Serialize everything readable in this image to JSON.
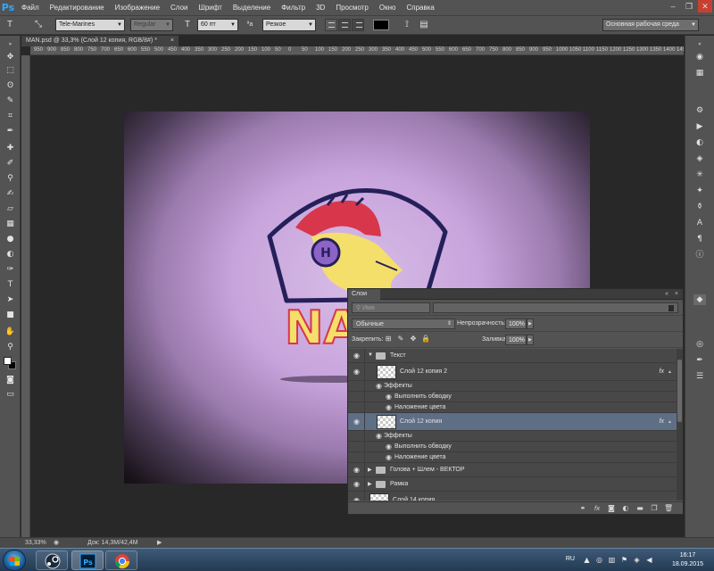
{
  "app": {
    "logo": "Ps"
  },
  "menu": [
    "Файл",
    "Редактирование",
    "Изображение",
    "Слои",
    "Шрифт",
    "Выделение",
    "Фильтр",
    "3D",
    "Просмотр",
    "Окно",
    "Справка"
  ],
  "window_controls": {
    "minimize": "–",
    "restore": "❐",
    "close": "✕"
  },
  "options": {
    "font_family": "Tele-Marines",
    "font_style": "Regular",
    "font_size": "60 пт",
    "antialias_label": "ªa",
    "antialias": "Резкое",
    "text_color": "#000000",
    "workspace": "Основная рабочая среда"
  },
  "document_tab": {
    "title": "MAN.psd @ 33,3% (Слой 12 копия, RGB/8#) *",
    "close": "×"
  },
  "ruler_h_ticks": [
    "950",
    "900",
    "850",
    "800",
    "750",
    "700",
    "650",
    "600",
    "550",
    "500",
    "450",
    "400",
    "350",
    "300",
    "250",
    "200",
    "150",
    "100",
    "50",
    "0",
    "50",
    "100",
    "150",
    "200",
    "250",
    "300",
    "350",
    "400",
    "450",
    "500",
    "550",
    "600",
    "650",
    "700",
    "750",
    "800",
    "850",
    "900",
    "950",
    "1000",
    "1050",
    "1100",
    "1150",
    "1200",
    "1250",
    "1300",
    "1350",
    "1400",
    "1450"
  ],
  "canvas": {
    "logo_text": "NAN",
    "colors": {
      "background": "#c8a4dc",
      "shield_outline": "#25205a",
      "helmet": "#d8364a",
      "face": "#f5df6b",
      "headphone": "#8e63c8",
      "letters": "#f5df6b"
    }
  },
  "layers_panel": {
    "title": "Слои",
    "search_placeholder": "Имя",
    "blend_mode": "Обычные",
    "opacity_label": "Непрозрачность:",
    "opacity_value": "100%",
    "lock_label": "Закрепить:",
    "fill_label": "Заливка:",
    "fill_value": "100%",
    "layers": [
      {
        "name": "Текст",
        "type": "group",
        "expanded": true
      },
      {
        "name": "Слой 12 копия 2",
        "type": "layer",
        "fx": "fx"
      },
      {
        "name": "Эффекты",
        "type": "effects"
      },
      {
        "name": "Выполнить обводку",
        "type": "effect"
      },
      {
        "name": "Наложение цвета",
        "type": "effect"
      },
      {
        "name": "Слой 12 копия",
        "type": "layer",
        "fx": "fx",
        "selected": true
      },
      {
        "name": "Эффекты",
        "type": "effects"
      },
      {
        "name": "Выполнить обводку",
        "type": "effect"
      },
      {
        "name": "Наложение цвета",
        "type": "effect"
      },
      {
        "name": "Голова + Шлем - ВЕКТОР",
        "type": "group"
      },
      {
        "name": "Рамка",
        "type": "group"
      },
      {
        "name": "Слой 14 копия",
        "type": "layer"
      }
    ]
  },
  "status": {
    "zoom": "33,33%",
    "doc": "Док: 14,3M/42,4M"
  },
  "taskbar": {
    "time": "16:17",
    "date": "18.09.2015",
    "lang": "RU"
  }
}
